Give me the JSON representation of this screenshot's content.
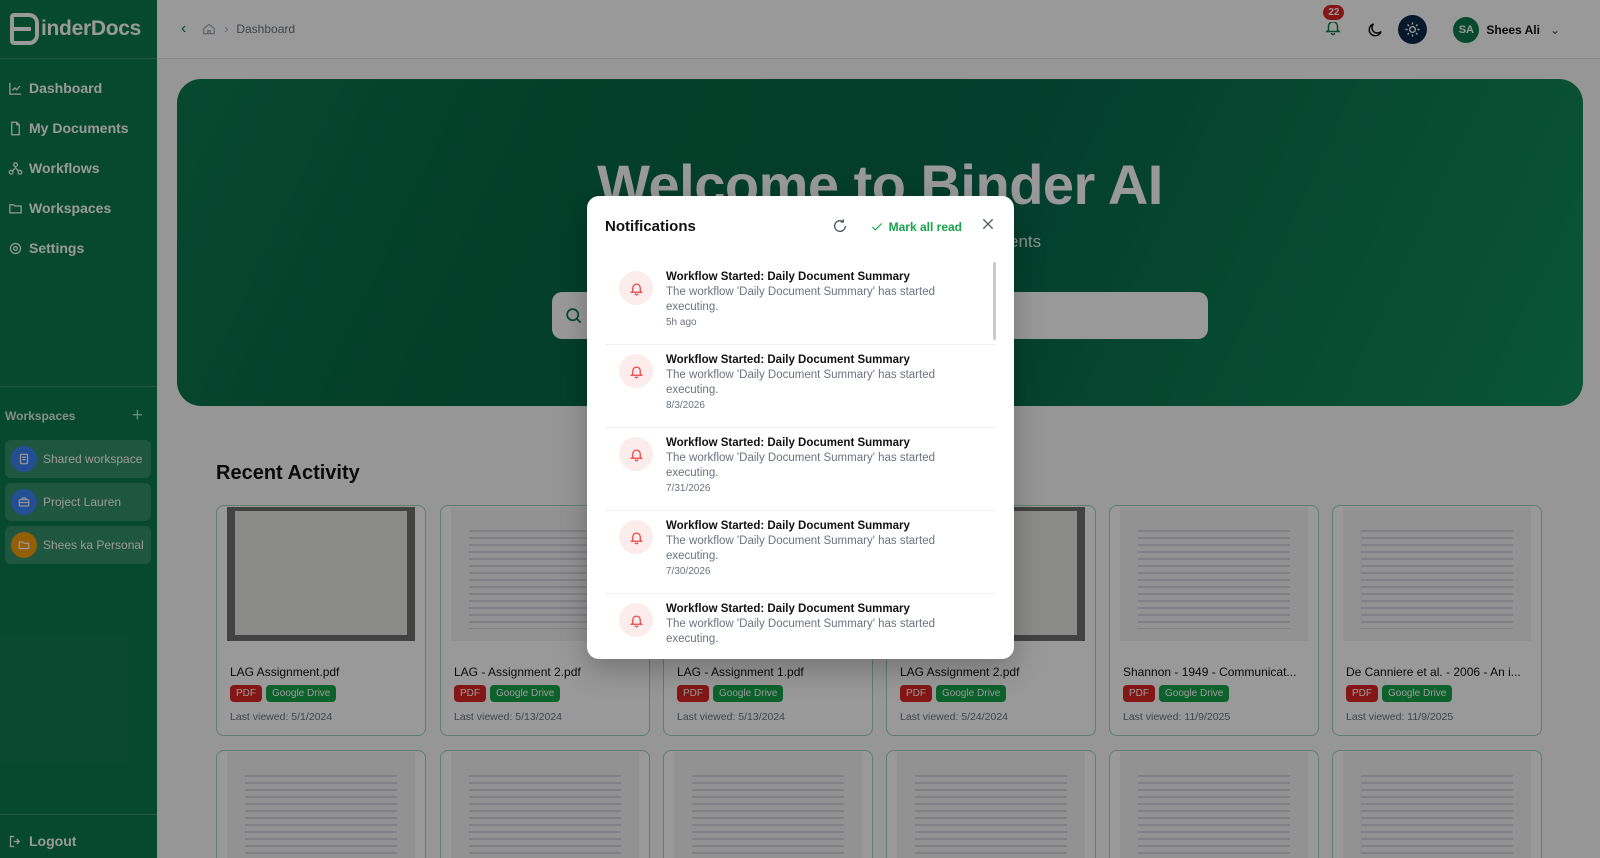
{
  "brand": {
    "logo_text": "inderDocs",
    "accent": "#0d7a4f"
  },
  "sidebar": {
    "nav": [
      {
        "label": "Dashboard",
        "icon": "chart-line-icon"
      },
      {
        "label": "My Documents",
        "icon": "file-icon"
      },
      {
        "label": "Workflows",
        "icon": "workflow-icon"
      },
      {
        "label": "Workspaces",
        "icon": "folder-icon"
      },
      {
        "label": "Settings",
        "icon": "gear-icon"
      }
    ],
    "workspaces_label": "Workspaces",
    "add_symbol": "+",
    "workspaces": [
      {
        "label": "Shared workspace",
        "color": "#3b82f6",
        "icon": "document-icon"
      },
      {
        "label": "Project Lauren",
        "color": "#3b82f6",
        "icon": "briefcase-icon"
      },
      {
        "label": "Shees ka Personal",
        "color": "#f59e0b",
        "icon": "folder-icon"
      }
    ],
    "logout_label": "Logout"
  },
  "topbar": {
    "breadcrumb": [
      "Dashboard"
    ],
    "notification_count": "22",
    "user": {
      "initials": "SA",
      "name": "Shees Ali"
    }
  },
  "hero": {
    "title": "Welcome to Binder AI",
    "subtitle": "ments",
    "search_placeholder": ""
  },
  "recent": {
    "title": "Recent Activity",
    "cards": [
      {
        "name": "LAG Assignment.pdf",
        "type": "PDF",
        "source": "Google Drive",
        "viewed": "Last viewed: 5/1/2024"
      },
      {
        "name": "LAG - Assignment 2.pdf",
        "type": "PDF",
        "source": "Google Drive",
        "viewed": "Last viewed: 5/13/2024"
      },
      {
        "name": "LAG - Assignment 1.pdf",
        "type": "PDF",
        "source": "Google Drive",
        "viewed": "Last viewed: 5/13/2024"
      },
      {
        "name": "LAG Assignment 2.pdf",
        "type": "PDF",
        "source": "Google Drive",
        "viewed": "Last viewed: 5/24/2024"
      },
      {
        "name": "Shannon - 1949 - Communicat...",
        "type": "PDF",
        "source": "Google Drive",
        "viewed": "Last viewed: 11/9/2025"
      },
      {
        "name": "De Canniere et al. - 2006 - An i...",
        "type": "PDF",
        "source": "Google Drive",
        "viewed": "Last viewed: 11/9/2025"
      }
    ]
  },
  "notifications": {
    "title": "Notifications",
    "mark_all_label": "Mark all read",
    "items": [
      {
        "title": "Workflow Started: Daily Document Summary",
        "message": "The workflow 'Daily Document Summary' has started executing.",
        "time": "5h ago"
      },
      {
        "title": "Workflow Started: Daily Document Summary",
        "message": "The workflow 'Daily Document Summary' has started executing.",
        "time": "8/3/2026"
      },
      {
        "title": "Workflow Started: Daily Document Summary",
        "message": "The workflow 'Daily Document Summary' has started executing.",
        "time": "7/31/2026"
      },
      {
        "title": "Workflow Started: Daily Document Summary",
        "message": "The workflow 'Daily Document Summary' has started executing.",
        "time": "7/30/2026"
      },
      {
        "title": "Workflow Started: Daily Document Summary",
        "message": "The workflow 'Daily Document Summary' has started executing.",
        "time": ""
      }
    ]
  }
}
